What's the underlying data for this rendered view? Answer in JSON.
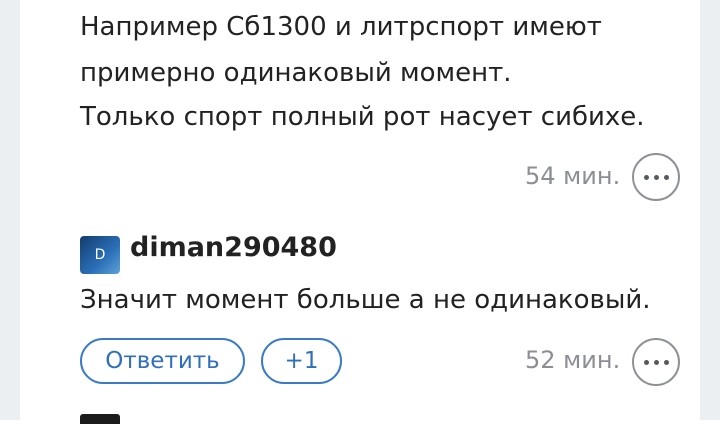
{
  "comment_1": {
    "lines": [
      "Например Сб1300 и литрспорт имеют",
      "примерно одинаковый момент.",
      "Только спорт полный рот насует сибихе."
    ],
    "time": "54 мин."
  },
  "comment_2": {
    "avatar_letter": "D",
    "username": "diman290480",
    "text": "Значит момент больше а не одинаковый.",
    "reply_label": "Ответить",
    "vote_label": "+1",
    "time": "52 мин."
  },
  "colors": {
    "accent": "#3a7bc8",
    "muted": "#8b8f94",
    "rail": "#eceff2"
  },
  "icons": {
    "more": "more-horizontal-icon"
  }
}
